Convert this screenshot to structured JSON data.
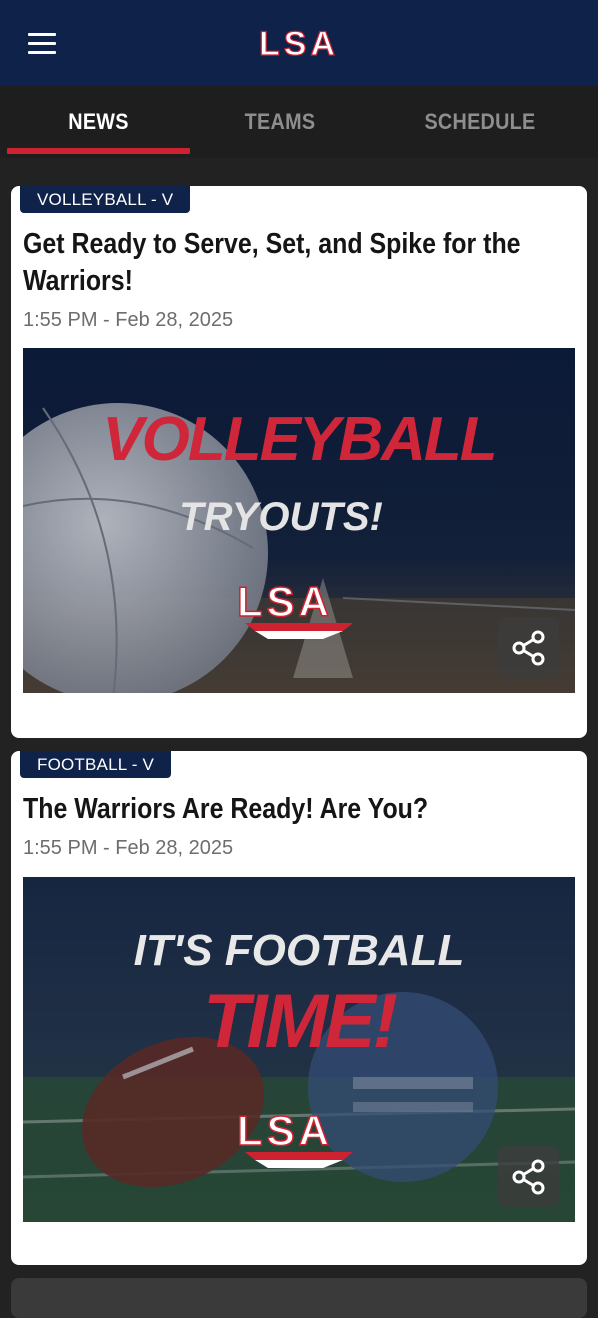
{
  "header": {
    "logo_text": "LSA",
    "menu_icon": "hamburger-menu-icon"
  },
  "tabs": [
    {
      "label": "NEWS",
      "active": true
    },
    {
      "label": "TEAMS",
      "active": false
    },
    {
      "label": "SCHEDULE",
      "active": false
    }
  ],
  "colors": {
    "navy": "#0f2249",
    "accent_red": "#cf2231",
    "background": "#222222"
  },
  "articles": [
    {
      "category": "VOLLEYBALL - V",
      "title": "Get Ready to Serve, Set, and Spike for the Warriors!",
      "time": "1:55 PM - Feb 28, 2025",
      "image_text_main": "VOLLEYBALL",
      "image_text_sub": "TRYOUTS!",
      "image_logo_text": "LSA",
      "share_icon": "share-icon"
    },
    {
      "category": "FOOTBALL - V",
      "title": "The Warriors Are Ready! Are You?",
      "time": "1:55 PM - Feb 28, 2025",
      "image_text_main": "IT'S FOOTBALL",
      "image_text_sub": "TIME!",
      "image_logo_text": "LSA",
      "share_icon": "share-icon"
    }
  ]
}
